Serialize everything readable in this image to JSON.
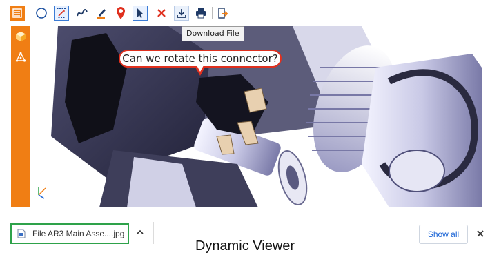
{
  "toolbar": {
    "tools": [
      {
        "name": "menu-icon"
      },
      {
        "name": "compass-icon"
      },
      {
        "name": "select-markup-icon",
        "selected": true
      },
      {
        "name": "freehand-icon"
      },
      {
        "name": "highlighter-icon"
      },
      {
        "name": "location-pin-icon"
      },
      {
        "name": "pointer-icon",
        "selected": true
      },
      {
        "name": "delete-icon"
      },
      {
        "name": "download-icon"
      },
      {
        "name": "print-icon"
      },
      {
        "name": "export-icon"
      }
    ],
    "tooltip": "Download File"
  },
  "sidebar": {
    "items": [
      {
        "name": "cube-icon"
      },
      {
        "name": "assembly-tree-icon"
      }
    ],
    "color": "#f07e14"
  },
  "annotation": {
    "text": "Can we rotate this connector?",
    "color": "#e0301e"
  },
  "download_bar": {
    "file_name": "File AR3 Main Asse....jpg",
    "show_all": "Show all",
    "highlight_color": "#2ea24a"
  },
  "caption": "Dynamic Viewer"
}
